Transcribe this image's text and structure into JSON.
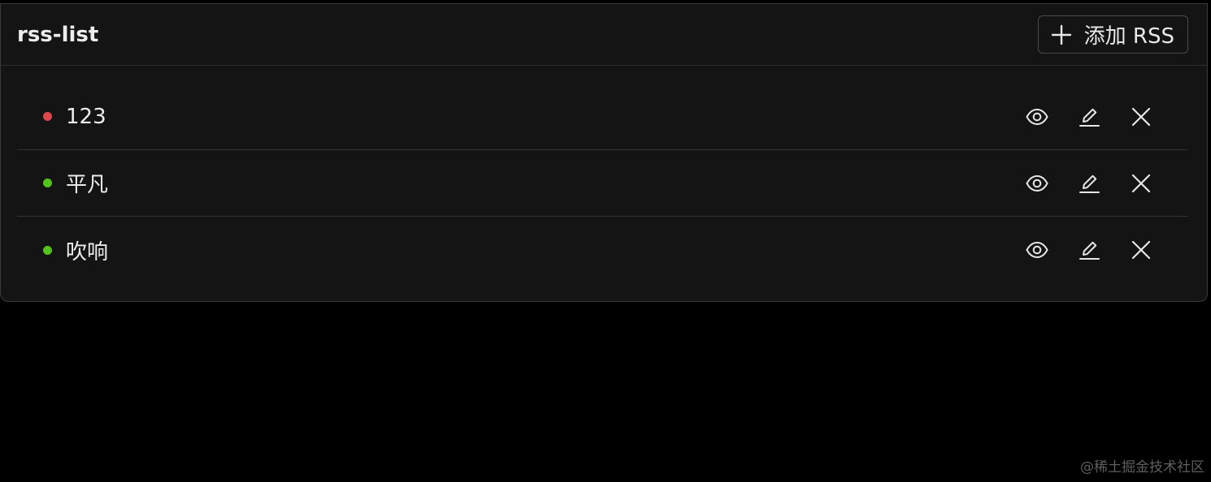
{
  "header": {
    "title": "rss-list",
    "add_button_label": "添加 RSS",
    "add_icon": "plus-icon"
  },
  "feeds": [
    {
      "name": "123",
      "status_color": "#e0474c"
    },
    {
      "name": "平凡",
      "status_color": "#52c41a"
    },
    {
      "name": "吹响",
      "status_color": "#52c41a"
    }
  ],
  "row_actions": [
    "eye-icon",
    "edit-icon",
    "close-icon"
  ],
  "watermark": "@稀土掘金技术社区"
}
